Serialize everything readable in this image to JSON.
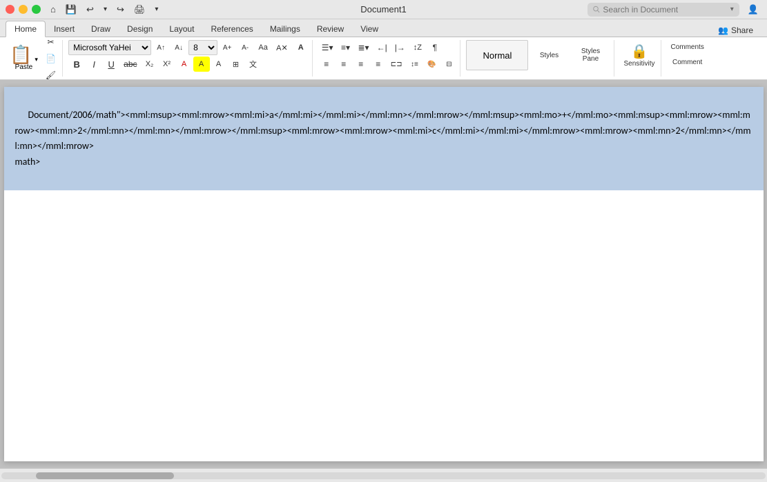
{
  "titlebar": {
    "title": "Document1",
    "search_placeholder": "Search in Document"
  },
  "tabs": {
    "items": [
      "Home",
      "Insert",
      "Draw",
      "Design",
      "Layout",
      "References",
      "Mailings",
      "Review",
      "View"
    ],
    "active": "Home"
  },
  "ribbon": {
    "paste_label": "Paste",
    "font_name": "Microsoft YaHei",
    "font_size": "8",
    "styles_label": "Styles",
    "styles_pane_label": "Styles\nPane",
    "sensitivity_label": "Sensitivity",
    "comments_label": "Comments",
    "comment_label": "Comment"
  },
  "share": {
    "label": "Share"
  },
  "document": {
    "content": "Document/2006/math\"><mml:msup><mml:mrow><mml:mi>a</mml:mi></mml:mi></mml:mn></mml:mrow></mml:msup><mml:mo>+</mml:mo><mml:msup><mml:mrow><mml:mrow><mml:mn>2</mml:mn></mml:mn></mml:mrow></mml:msup><mml:mrow><mml:mrow><mml:mi>c</mml:mi></mml:mi></mml:mrow><mml:mrow><mml:mn>2</mml:mn></mml:mn></mml:mrow>\nmath>"
  }
}
